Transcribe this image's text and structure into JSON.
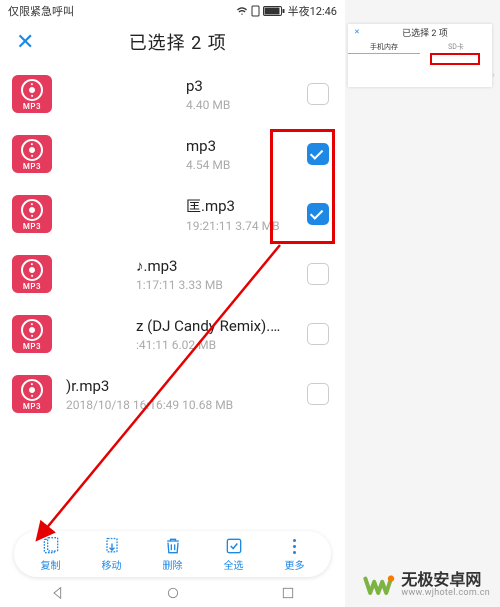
{
  "status": {
    "left": "仅限紧急呼叫",
    "time": "半夜12:46"
  },
  "header": {
    "title": "已选择 2 项"
  },
  "files": [
    {
      "name": "p3",
      "meta": "4.40 MB",
      "checked": false,
      "text_indent": 120
    },
    {
      "name": "mp3",
      "meta": "4.54 MB",
      "checked": true,
      "text_indent": 120
    },
    {
      "name": "匡.mp3",
      "meta": "19:21:11 3.74 MB",
      "checked": true,
      "text_indent": 120
    },
    {
      "name": "♪.mp3",
      "meta": "1:17:11 3.33 MB",
      "checked": false,
      "text_indent": 70
    },
    {
      "name": "z (DJ Candy Remix).m…",
      "meta": ":41:11 6.02 MB",
      "checked": false,
      "text_indent": 70
    },
    {
      "name": ")r.mp3",
      "meta": "2018/10/18 16:16:49 10.68 MB",
      "checked": false,
      "text_indent": 0
    }
  ],
  "toolbar": {
    "copy": "复制",
    "move": "移动",
    "delete": "删除",
    "all": "全选",
    "more": "更多"
  },
  "mp3_label": "MP3",
  "thumb": {
    "title": "已选择 2 项",
    "tab1": "手机内存",
    "tab2": "SD卡"
  },
  "watermark": {
    "cn": "无极安卓网",
    "en": "www.wjhotel.com.cn"
  }
}
